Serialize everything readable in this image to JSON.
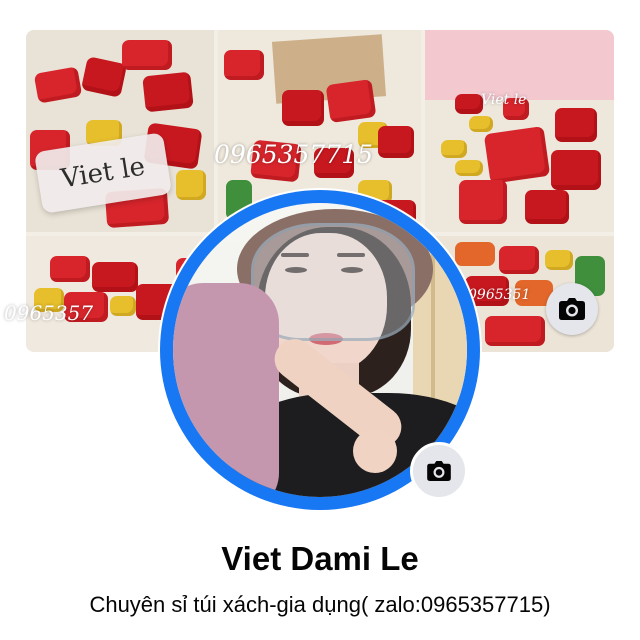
{
  "profile": {
    "name": "Viet Dami Le",
    "bio": "Chuyên sỉ túi xách-gia dụng( zalo:0965357715)"
  },
  "cover": {
    "watermark_badge": "Viet le",
    "watermark_phone": "0965357715",
    "watermark_phone_partial_left": "0965357",
    "watermark_phone_partial_right": "0965351",
    "watermark_name_small": "Viet le"
  },
  "icons": {
    "cover_camera": "camera-icon",
    "profile_camera": "camera-icon"
  },
  "colors": {
    "ring": "#1877f2",
    "camera_button_bg": "#e4e6eb",
    "text": "#050505"
  }
}
